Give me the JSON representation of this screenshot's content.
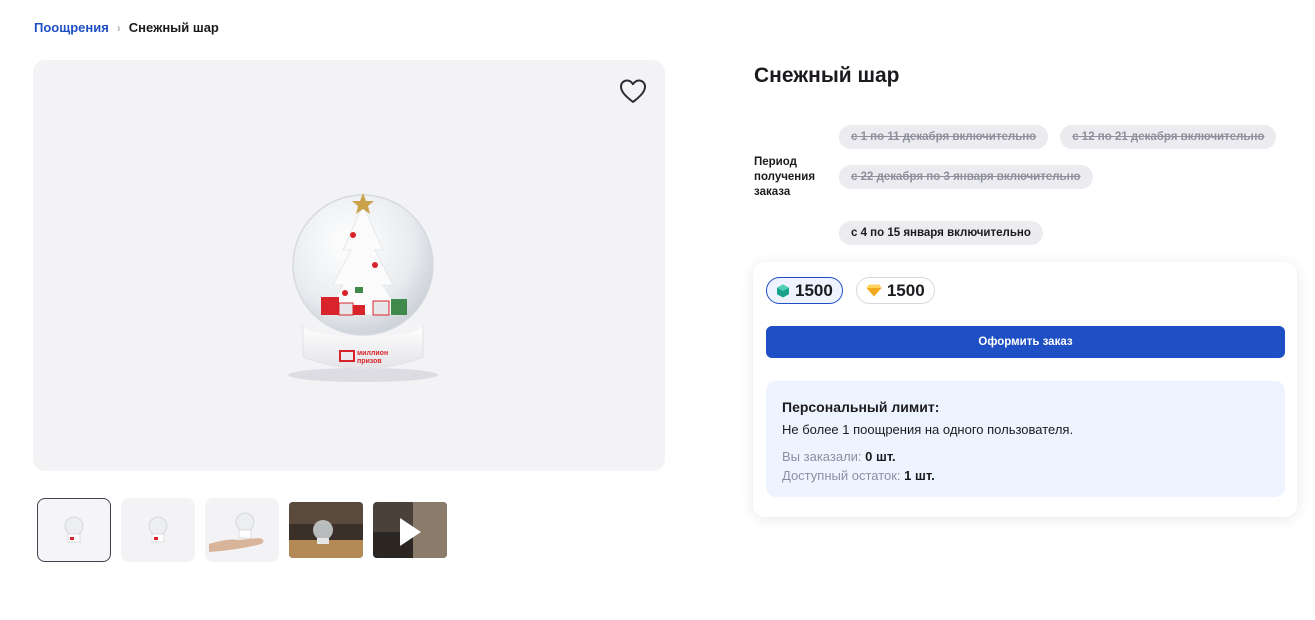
{
  "breadcrumb": {
    "parent": "Поощрения",
    "separator": "›",
    "current": "Снежный шар"
  },
  "product": {
    "title": "Снежный шар",
    "image_brand_text": [
      "миллион",
      "призов"
    ]
  },
  "thumbnails": [
    {
      "kind": "product-front",
      "active": true
    },
    {
      "kind": "product-front",
      "active": false
    },
    {
      "kind": "product-in-hand",
      "active": false
    },
    {
      "kind": "photo",
      "active": false
    },
    {
      "kind": "video",
      "active": false
    }
  ],
  "period": {
    "label": "Период получения заказа",
    "options": [
      {
        "text": "с 1 по 11 декабря включительно",
        "available": false
      },
      {
        "text": "с 12 по 21 декабря включительно",
        "available": false
      },
      {
        "text": "с 22 декабря по 3 января включительно",
        "available": false
      },
      {
        "text": "с 4 по 15 января включительно",
        "available": true
      }
    ]
  },
  "prices": [
    {
      "icon": "teal-gem-icon",
      "value": "1500",
      "selected": true,
      "color": "#1aa38a"
    },
    {
      "icon": "gold-diamond-icon",
      "value": "1500",
      "selected": false,
      "color": "#f0a81c"
    }
  ],
  "order_button": "Оформить заказ",
  "limit": {
    "title": "Персональный лимит:",
    "text": "Не более 1 поощрения на одного пользователя.",
    "ordered_label": "Вы заказали:",
    "ordered_value": "0 шт.",
    "remaining_label": "Доступный остаток:",
    "remaining_value": "1 шт."
  },
  "colors": {
    "accent": "#1f4fc4",
    "limit_bg": "#eef4ff",
    "brand_red": "#d8232a"
  }
}
